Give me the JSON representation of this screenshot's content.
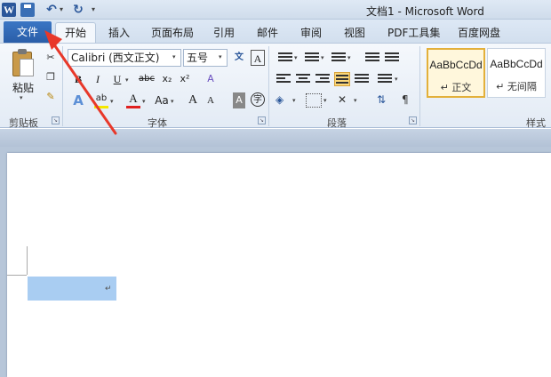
{
  "window": {
    "title": "文档1 - Microsoft Word"
  },
  "quick_access": {
    "app_icon_letter": "W",
    "undo_symbol": "↶",
    "redo_symbol": "↻",
    "dropdown_symbol": "▾"
  },
  "tabs": [
    {
      "label": "文件"
    },
    {
      "label": "开始"
    },
    {
      "label": "插入"
    },
    {
      "label": "页面布局"
    },
    {
      "label": "引用"
    },
    {
      "label": "邮件"
    },
    {
      "label": "审阅"
    },
    {
      "label": "视图"
    },
    {
      "label": "PDF工具集"
    },
    {
      "label": "百度网盘"
    }
  ],
  "clipboard": {
    "paste_label": "粘贴",
    "group_label": "剪贴板",
    "cut_symbol": "✂",
    "copy_symbol": "❐",
    "brush_symbol": "✎"
  },
  "font": {
    "name": "Calibri (西文正文)",
    "size": "五号",
    "group_label": "字体",
    "bold": "B",
    "italic": "I",
    "underline": "U",
    "strike": "abc",
    "subscript": "x₂",
    "superscript": "x²",
    "grow": "A",
    "shrink": "A",
    "change_case": "Aa",
    "font_color": "A",
    "highlight": "ab",
    "clear_format": "A",
    "phonetic": "文",
    "char_border": "A",
    "enclose_char": "字",
    "effects": "A"
  },
  "paragraph": {
    "group_label": "段落"
  },
  "styles": {
    "group_label": "样式",
    "items": [
      {
        "sample": "AaBbCcDd",
        "name": "↵ 正文"
      },
      {
        "sample": "AaBbCcDd",
        "name": "↵ 无间隔"
      }
    ]
  },
  "document": {
    "paragraph_mark": "↵"
  },
  "colors": {
    "file_tab": "#2a5ea8",
    "annotation_arrow": "#e8382a",
    "selection": "#a9cdf2",
    "highlight_yellow": "#f5e800",
    "font_red": "#e02020"
  }
}
